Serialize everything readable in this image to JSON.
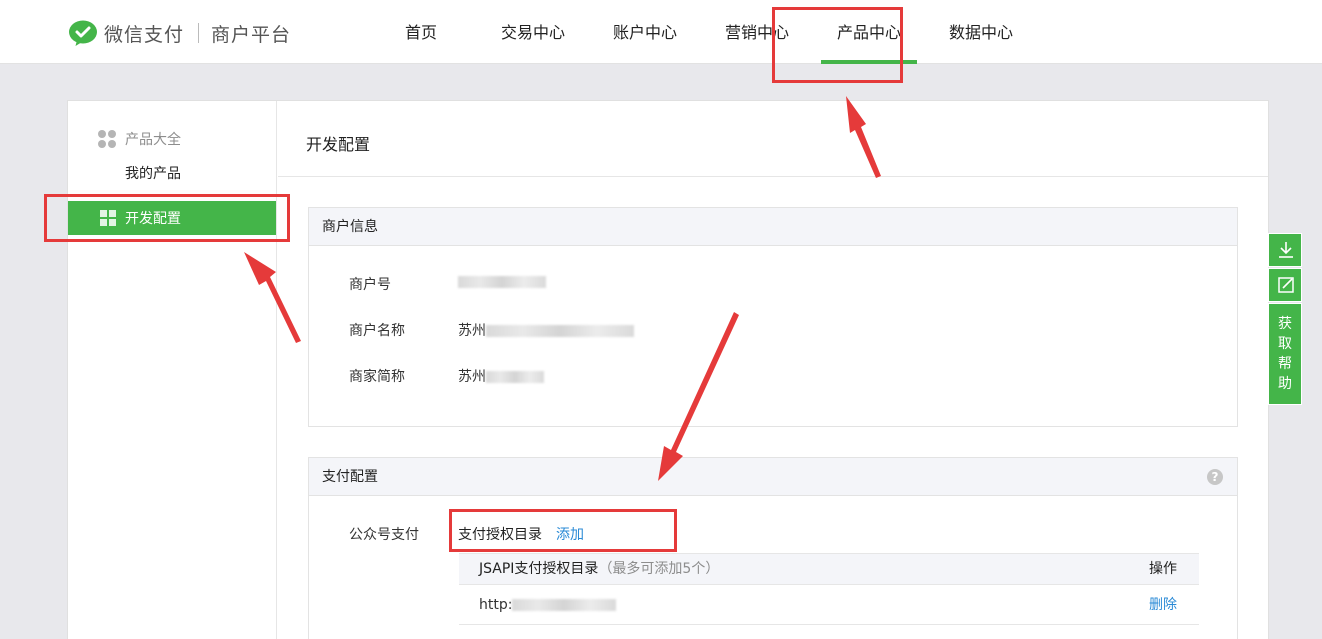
{
  "header": {
    "brand": "微信支付",
    "subtitle": "商户平台",
    "nav": [
      {
        "label": "首页"
      },
      {
        "label": "交易中心"
      },
      {
        "label": "账户中心"
      },
      {
        "label": "营销中心"
      },
      {
        "label": "产品中心",
        "active": true
      },
      {
        "label": "数据中心"
      }
    ]
  },
  "sidebar": {
    "group": "产品大全",
    "my_products": "我的产品",
    "active_item": "开发配置"
  },
  "main": {
    "title": "开发配置",
    "merchant_info": {
      "heading": "商户信息",
      "rows": [
        {
          "label": "商户号",
          "value": ""
        },
        {
          "label": "商户名称",
          "value": "苏州"
        },
        {
          "label": "商家简称",
          "value": "苏州"
        }
      ]
    },
    "pay_config": {
      "heading": "支付配置",
      "help": "?",
      "row_label": "公众号支付",
      "auth_dir_label": "支付授权目录",
      "add_link": "添加",
      "table": {
        "title": "JSAPI支付授权目录",
        "note": "（最多可添加5个）",
        "op_header": "操作",
        "rows": [
          {
            "url": "http:",
            "action": "删除"
          }
        ]
      }
    }
  },
  "tools": {
    "help_label": [
      "获",
      "取",
      "帮",
      "助"
    ]
  },
  "colors": {
    "accent": "#44b549",
    "link": "#2a8ad6",
    "annotation": "#e53a3a"
  }
}
